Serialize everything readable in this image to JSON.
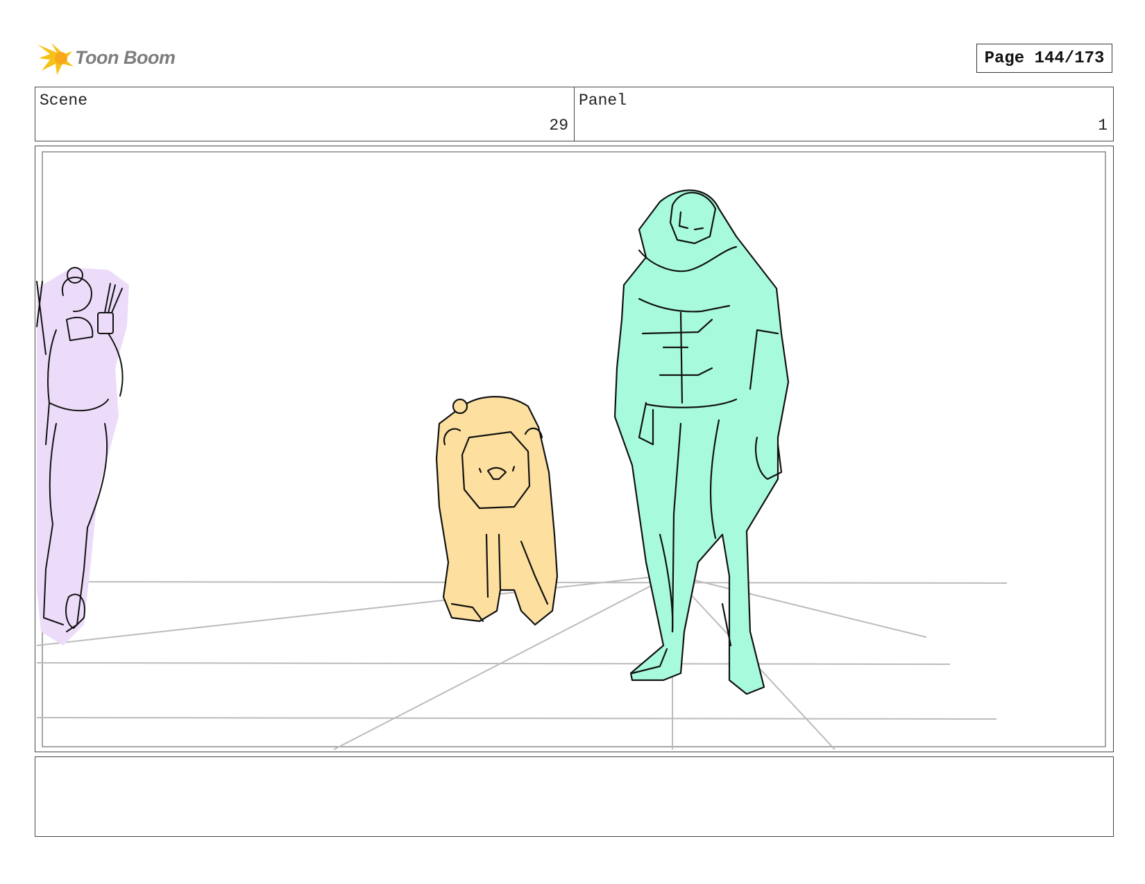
{
  "header": {
    "logo_text": "Toon Boom",
    "page_label": "Page 144/173"
  },
  "info": {
    "scene_label": "Scene",
    "scene_value": "29",
    "panel_label": "Panel",
    "panel_value": "1"
  },
  "colors": {
    "logo_yellow": "#f6c21a",
    "archer_fill": "#ecdcfa",
    "bear_fill": "#fde09f",
    "hero_fill": "#a7fbdc",
    "guide_lines": "#bbbbbb"
  },
  "caption": {
    "text": ""
  }
}
